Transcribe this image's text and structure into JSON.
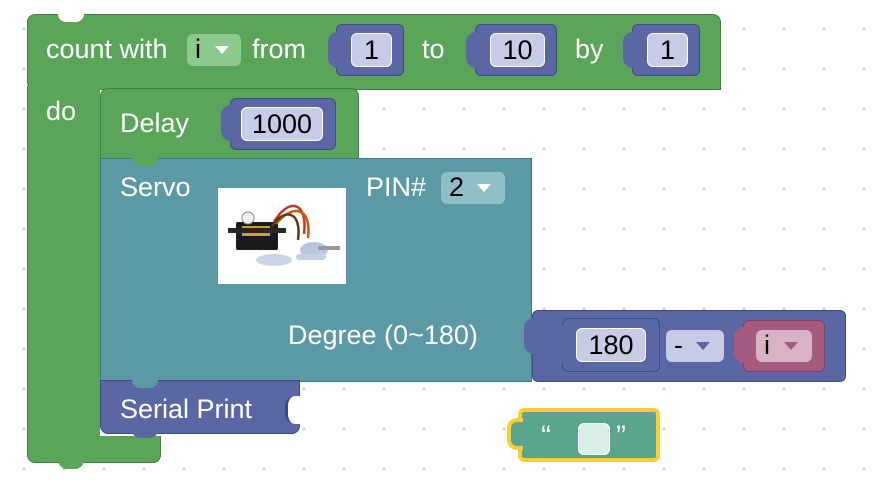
{
  "loop": {
    "label_count": "count with",
    "variable": "i",
    "label_from": "from",
    "from_value": "1",
    "label_to": "to",
    "to_value": "10",
    "label_by": "by",
    "by_value": "1",
    "label_do": "do"
  },
  "delay": {
    "label": "Delay",
    "value": "1000"
  },
  "servo": {
    "label": "Servo",
    "pin_label": "PIN#",
    "pin_value": "2",
    "degree_label": "Degree (0~180)",
    "image_icon": "servo-motor-photo"
  },
  "math": {
    "left_value": "180",
    "operator": "-",
    "right_variable": "i"
  },
  "serial": {
    "label": "Serial Print"
  },
  "text_block": {
    "open_quote": "“",
    "close_quote": "”",
    "value": ""
  },
  "colors": {
    "loop": "#5ba55b",
    "math": "#5b67a5",
    "servo": "#5b9aa5",
    "variable": "#a55b80",
    "text": "#5ba58c",
    "selection": "#fc3"
  }
}
